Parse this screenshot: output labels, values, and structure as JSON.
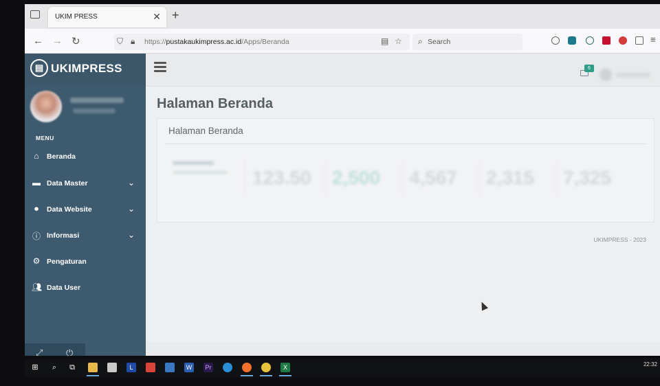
{
  "browser": {
    "tab_title": "UKIM PRESS",
    "url_prefix": "https://",
    "url_domain": "pustakaukimpress.ac.id",
    "url_path": "/Apps/Beranda",
    "search_placeholder": "Search"
  },
  "sidebar": {
    "brand": "UKIMPRESS",
    "menu_header": "MENU",
    "items": [
      {
        "label": "Beranda",
        "icon": "home-icon",
        "has_children": false
      },
      {
        "label": "Data Master",
        "icon": "folder-icon",
        "has_children": true
      },
      {
        "label": "Data Website",
        "icon": "toggle-icon",
        "has_children": true
      },
      {
        "label": "Informasi",
        "icon": "info-icon",
        "has_children": true
      },
      {
        "label": "Pengaturan",
        "icon": "gear-icon",
        "has_children": false
      },
      {
        "label": "Data User",
        "icon": "users-icon",
        "has_children": false
      }
    ]
  },
  "topbar": {
    "mail_badge": "6"
  },
  "main": {
    "page_title": "Halaman Beranda",
    "card_title": "Halaman Beranda",
    "stats": [
      {
        "value": "123.50"
      },
      {
        "value": "2,500"
      },
      {
        "value": "4,567"
      },
      {
        "value": "2,315"
      },
      {
        "value": "7,325"
      }
    ],
    "footer": "UKIMPRESS - 2023"
  },
  "taskbar": {
    "clock": "22:32"
  },
  "colors": {
    "sidebar_bg": "#3d5a6e",
    "accent_green": "#2d9f88"
  }
}
